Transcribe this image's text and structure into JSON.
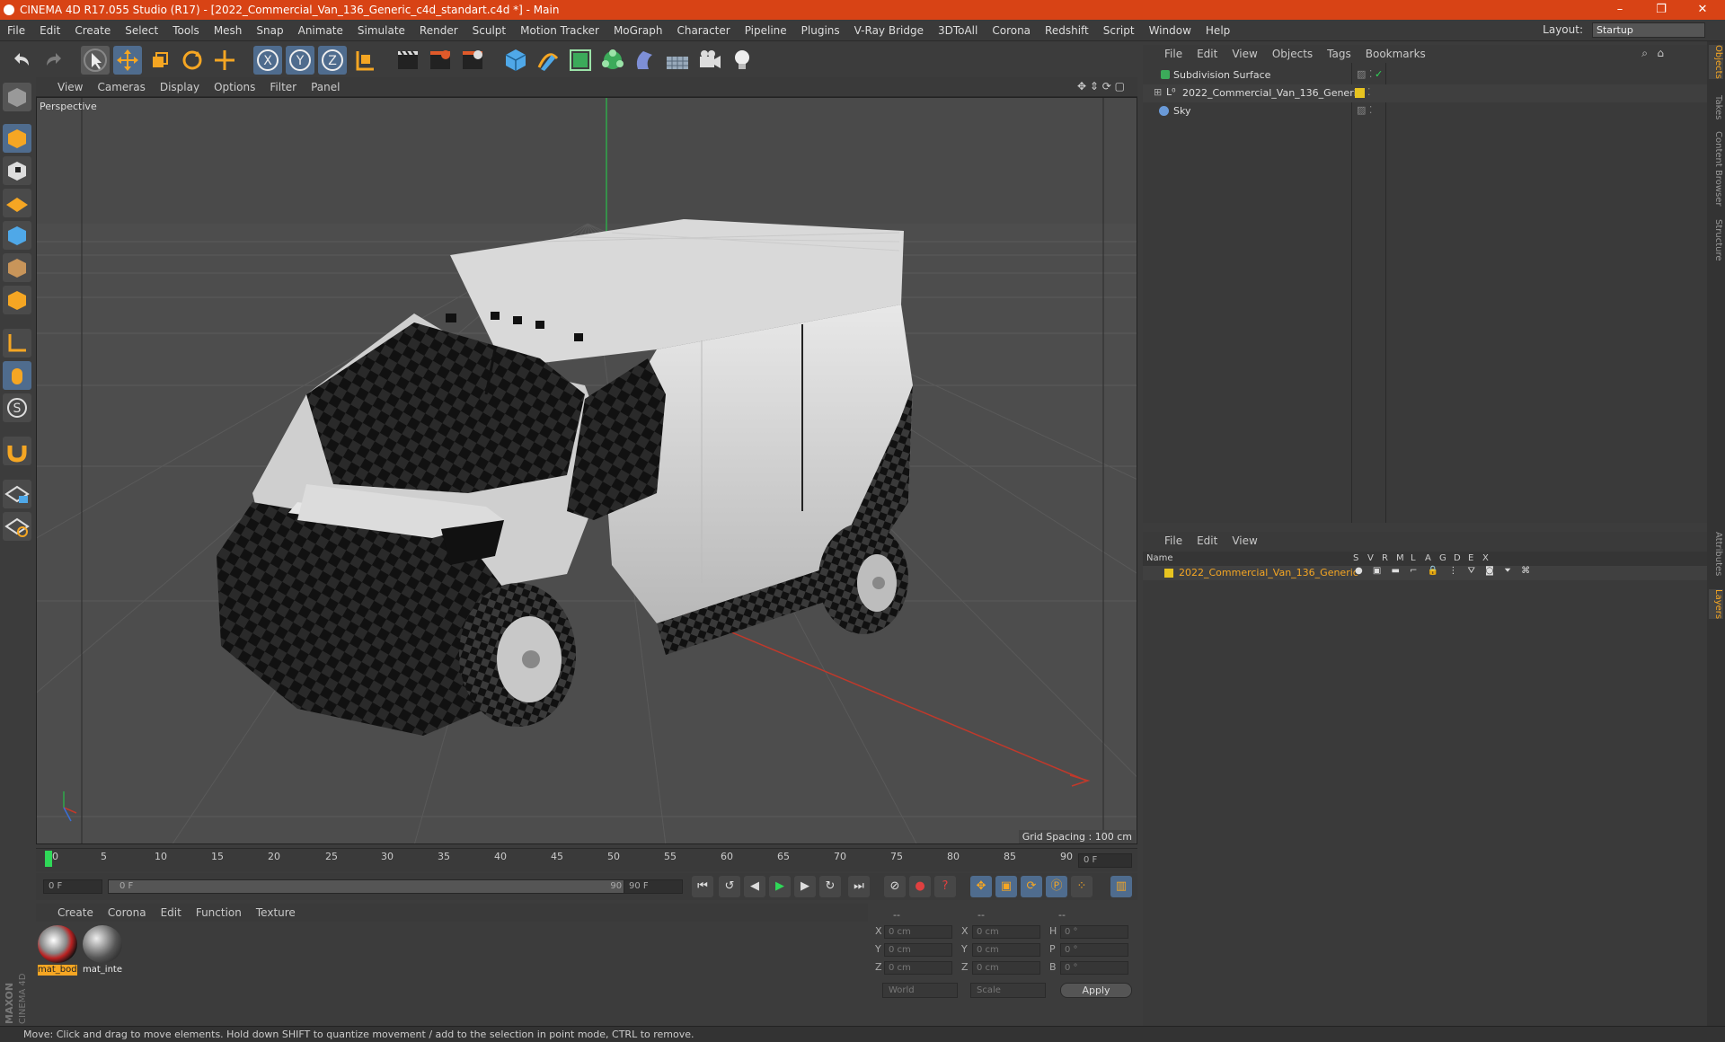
{
  "window": {
    "title": "CINEMA 4D R17.055 Studio (R17) - [2022_Commercial_Van_136_Generic_c4d_standart.c4d *] - Main",
    "minimize": "–",
    "restore": "❐",
    "close": "✕"
  },
  "menubar": {
    "items": [
      "File",
      "Edit",
      "Create",
      "Select",
      "Tools",
      "Mesh",
      "Snap",
      "Animate",
      "Simulate",
      "Render",
      "Sculpt",
      "Motion Tracker",
      "MoGraph",
      "Character",
      "Pipeline",
      "Plugins",
      "V-Ray Bridge",
      "3DToAll",
      "Corona",
      "Redshift",
      "Script",
      "Window",
      "Help"
    ],
    "layout_label": "Layout:",
    "layout_value": "Startup"
  },
  "toolbar": {
    "icons": [
      "undo-icon",
      "redo-icon",
      "select-arrow-icon",
      "move-icon",
      "scale-icon",
      "rotate-icon",
      "live-select-icon",
      "axis-x-icon",
      "axis-y-icon",
      "axis-z-icon",
      "world-coord-icon",
      "render-view-icon",
      "render-picture-queue-icon",
      "render-settings-icon",
      "cube-primitive-icon",
      "pen-spline-icon",
      "subdivision-icon",
      "mograph-cloner-icon",
      "deformer-icon",
      "floor-icon",
      "camera-icon",
      "light-icon"
    ]
  },
  "left_tools": [
    "model-mode-icon",
    "texture-mode-icon",
    "workplane-icon",
    "points-mode-icon",
    "edges-mode-icon",
    "polygons-mode-icon",
    "axis-mode-icon",
    "tweak-icon",
    "snap-icon",
    "magnet-icon",
    "lock-workplane-icon",
    "grid-snap-icon"
  ],
  "viewport": {
    "menu": [
      "View",
      "Cameras",
      "Display",
      "Options",
      "Filter",
      "Panel"
    ],
    "camera_label": "Perspective",
    "grid_spacing": "Grid Spacing : 100 cm"
  },
  "timeline": {
    "ticks": [
      "0",
      "5",
      "10",
      "15",
      "20",
      "25",
      "30",
      "35",
      "40",
      "45",
      "50",
      "55",
      "60",
      "65",
      "70",
      "75",
      "80",
      "85",
      "90"
    ],
    "current_frame": "0 F",
    "start_field": "0 F",
    "range_start": "0 F",
    "range_end": "90 F",
    "end_field": "90 F"
  },
  "material_manager": {
    "menu": [
      "Create",
      "Corona",
      "Edit",
      "Function",
      "Texture"
    ],
    "materials": [
      {
        "name": "mat_bod"
      },
      {
        "name": "mat_inte"
      }
    ]
  },
  "coordinates": {
    "headers": [
      "--",
      "--",
      "--"
    ],
    "rows": [
      {
        "a": "X",
        "av": "0 cm",
        "b": "X",
        "bv": "0 cm",
        "c": "H",
        "cv": "0 °"
      },
      {
        "a": "Y",
        "av": "0 cm",
        "b": "Y",
        "bv": "0 cm",
        "c": "P",
        "cv": "0 °"
      },
      {
        "a": "Z",
        "av": "0 cm",
        "b": "Z",
        "bv": "0 cm",
        "c": "B",
        "cv": "0 °"
      }
    ],
    "mode1": "World",
    "mode2": "Scale",
    "apply": "Apply"
  },
  "object_manager": {
    "menu": [
      "File",
      "Edit",
      "View",
      "Objects",
      "Tags",
      "Bookmarks"
    ],
    "objects": [
      {
        "name": "Subdivision Surface"
      },
      {
        "name": "2022_Commercial_Van_136_Generic"
      },
      {
        "name": "Sky"
      }
    ]
  },
  "layer_manager": {
    "menu": [
      "File",
      "Edit",
      "View"
    ],
    "columns": [
      "Name",
      "S",
      "V",
      "R",
      "M",
      "L",
      "A",
      "G",
      "D",
      "E",
      "X"
    ],
    "layers": [
      {
        "name": "2022_Commercial_Van_136_Generic",
        "color": "#e8c420"
      }
    ]
  },
  "right_tabs": [
    "Objects",
    "Takes",
    "Content Browser",
    "Structure",
    "Attributes",
    "Layers"
  ],
  "branding": {
    "maxon": "MAXON",
    "product": "CINEMA 4D"
  },
  "status": "Move: Click and drag to move elements. Hold down SHIFT to quantize movement / add to the selection in point mode, CTRL to remove.",
  "colors": {
    "accent": "#d84315",
    "highlight": "#f5a623",
    "layer": "#e8c420"
  }
}
